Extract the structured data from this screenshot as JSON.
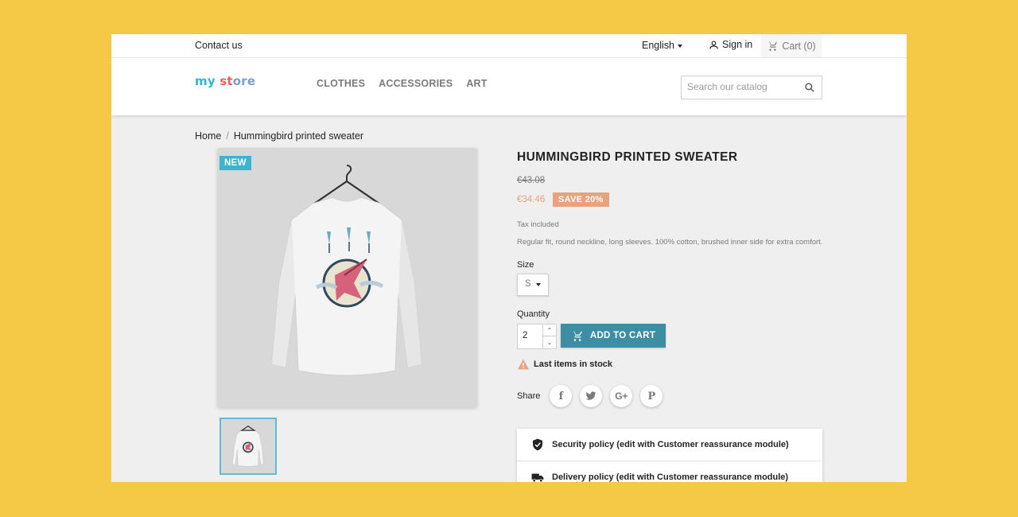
{
  "topbar": {
    "contact": "Contact us",
    "language": "English",
    "sign_in": "Sign in",
    "cart": "Cart (0)"
  },
  "header": {
    "logo_parts": [
      "my",
      " ",
      "st",
      "ore"
    ],
    "nav": [
      "CLOTHES",
      "ACCESSORIES",
      "ART"
    ],
    "search_placeholder": "Search our catalog"
  },
  "breadcrumb": {
    "home": "Home",
    "separator": "/",
    "current": "Hummingbird printed sweater"
  },
  "product": {
    "badge": "NEW",
    "title": "HUMMINGBIRD PRINTED SWEATER",
    "old_price": "€43.08",
    "price": "€34.46",
    "discount": "SAVE 20%",
    "tax": "Tax included",
    "description": "Regular fit, round neckline, long sleeves. 100% cotton, brushed inner side for extra comfort.",
    "size_label": "Size",
    "size_value": "S",
    "quantity_label": "Quantity",
    "quantity_value": "2",
    "add_to_cart": "ADD TO CART",
    "stock": "Last items in stock",
    "share_label": "Share"
  },
  "reassurance": [
    "Security policy (edit with Customer reassurance module)",
    "Delivery policy (edit with Customer reassurance module)"
  ],
  "colors": {
    "background": "#f5c945",
    "accent": "#3eb3d0",
    "cart_button": "#3d8da4",
    "discount": "#e9a27d"
  },
  "icons": [
    "user-icon",
    "cart-icon",
    "search-icon",
    "cart-button-icon",
    "warning-icon",
    "facebook-icon",
    "twitter-icon",
    "googleplus-icon",
    "pinterest-icon",
    "shield-icon",
    "truck-icon"
  ]
}
